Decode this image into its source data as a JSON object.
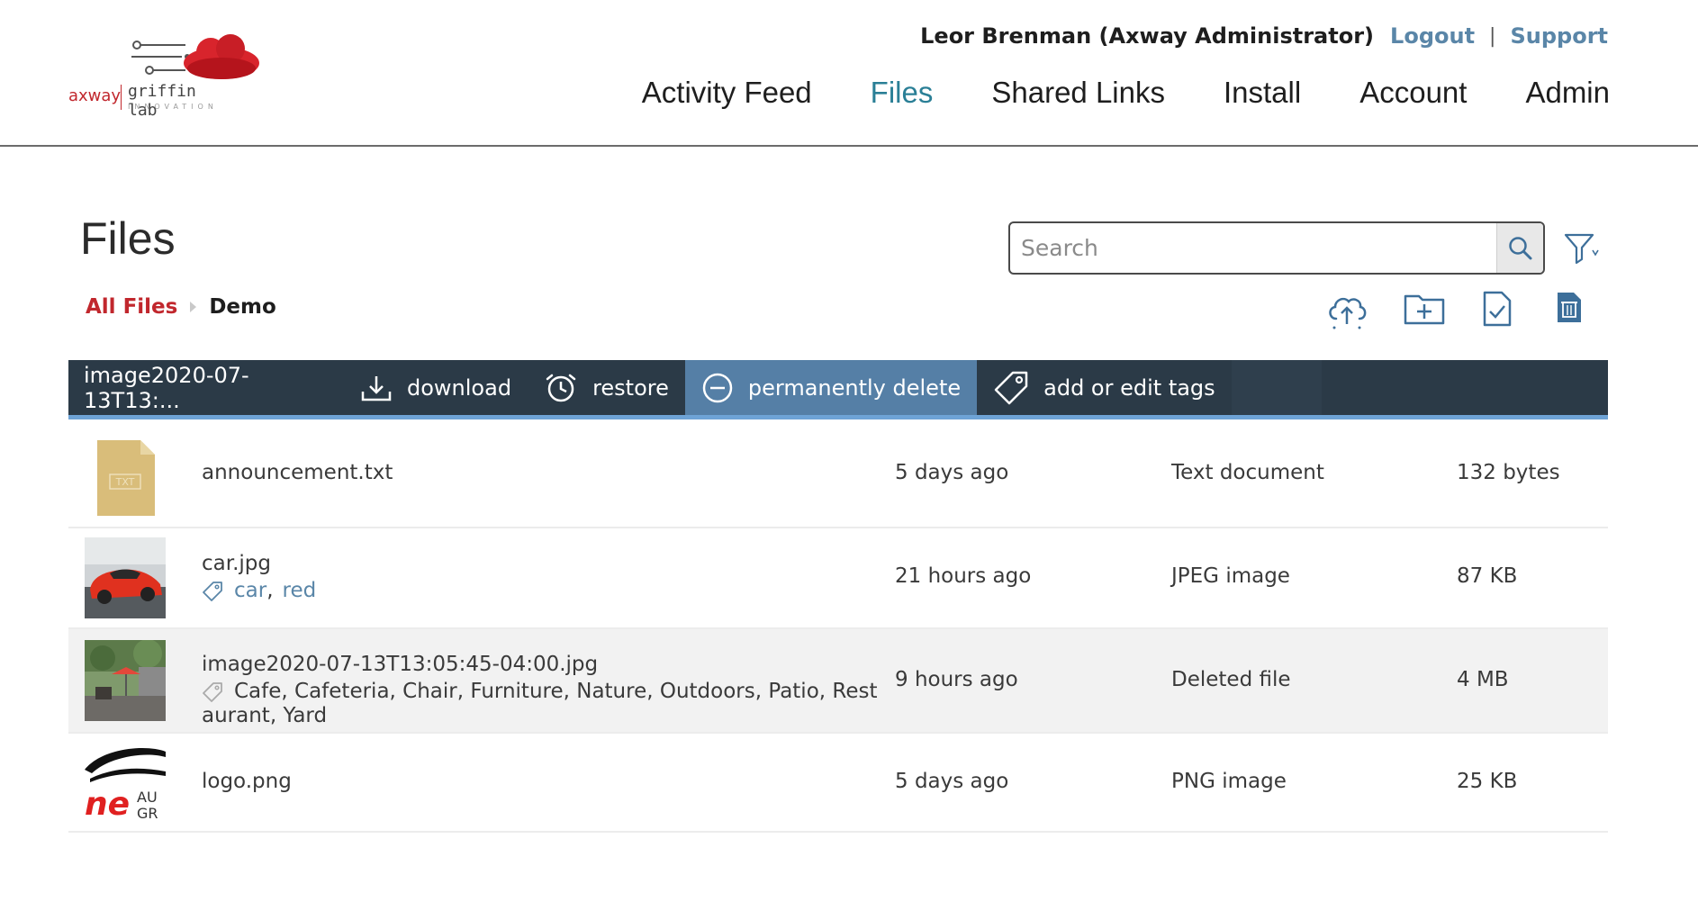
{
  "logo": {
    "brand": "axway",
    "product": "griffin lab",
    "tagline": "INNOVATION"
  },
  "user": {
    "name": "Leor Brenman (Axway Administrator)",
    "logout_label": "Logout",
    "separator": "|",
    "support_label": "Support"
  },
  "nav": {
    "items": [
      {
        "label": "Activity Feed",
        "active": false
      },
      {
        "label": "Files",
        "active": true
      },
      {
        "label": "Shared Links",
        "active": false
      },
      {
        "label": "Install",
        "active": false
      },
      {
        "label": "Account",
        "active": false
      },
      {
        "label": "Admin",
        "active": false
      }
    ]
  },
  "page": {
    "title": "Files",
    "breadcrumb": {
      "root": "All Files",
      "current": "Demo"
    }
  },
  "search": {
    "placeholder": "Search",
    "value": ""
  },
  "toolbar": {
    "selected_file": "image2020-07-13T13:...",
    "download_label": "download",
    "restore_label": "restore",
    "delete_label": "permanently delete",
    "tags_label": "add or edit tags"
  },
  "icons": {
    "search": "search-icon",
    "filter": "filter-icon",
    "upload": "cloud-upload-icon",
    "new_folder": "new-folder-icon",
    "select": "select-file-icon",
    "trash": "trash-icon",
    "download": "download-icon",
    "restore": "restore-clock-icon",
    "delete": "minus-circle-icon",
    "tag": "tag-icon"
  },
  "colors": {
    "brand_red": "#c1272d",
    "nav_active": "#2a7f96",
    "link_blue": "#5a86a8",
    "toolbar_bg": "#2b3a47",
    "toolbar_active": "#557fa6",
    "toolbar_accent": "#6ea3d6"
  },
  "files": [
    {
      "name": "announcement.txt",
      "thumb_text": "TXT",
      "tags": [],
      "modified": "5 days ago",
      "type": "Text document",
      "size": "132 bytes"
    },
    {
      "name": "car.jpg",
      "tags": [
        "car",
        "red"
      ],
      "tag_separator": ",",
      "modified": "21 hours ago",
      "type": "JPEG image",
      "size": "87 KB"
    },
    {
      "name": "image2020-07-13T13:05:45-04:00.jpg",
      "tags_text": "Cafe, Cafeteria, Chair, Furniture, Nature, Outdoors, Patio, Rest",
      "tags_text_cont": "aurant, Yard",
      "modified": "9 hours ago",
      "type": "Deleted file",
      "size": "4 MB"
    },
    {
      "name": "logo.png",
      "thumb_text_1": "ne",
      "thumb_text_2": "AU",
      "thumb_text_3": "GR",
      "tags": [],
      "modified": "5 days ago",
      "type": "PNG image",
      "size": "25 KB"
    }
  ]
}
